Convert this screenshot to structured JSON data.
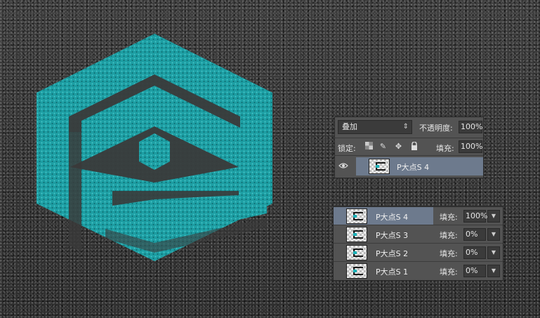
{
  "blend": {
    "mode": "叠加",
    "opacity_label": "不透明度:",
    "opacity_value": "100%"
  },
  "lock": {
    "label": "锁定:",
    "fill_label": "填充:",
    "fill_value": "100%"
  },
  "active_layer": {
    "name": "P大点S 4"
  },
  "layers": [
    {
      "name": "P大点S 4",
      "fill_label": "填充:",
      "fill_value": "100%",
      "selected": true
    },
    {
      "name": "P大点S 3",
      "fill_label": "填充:",
      "fill_value": "0%",
      "selected": false
    },
    {
      "name": "P大点S 2",
      "fill_label": "填充:",
      "fill_value": "0%",
      "selected": false
    },
    {
      "name": "P大点S 1",
      "fill_label": "填充:",
      "fill_value": "0%",
      "selected": false
    }
  ],
  "icons": [
    "checker-lock-icon",
    "brush-lock-icon",
    "move-lock-icon",
    "padlock-icon",
    "eye-icon",
    "chevron-down-icon"
  ],
  "colors": {
    "logo_teal": "#1d9ea3",
    "panel_bg": "#535353",
    "selection": "#6d7a8d"
  }
}
